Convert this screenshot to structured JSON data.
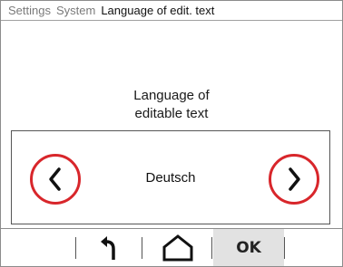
{
  "breadcrumb": {
    "items": [
      "Settings",
      "System"
    ],
    "current": "Language of edit. text"
  },
  "page": {
    "title_line1": "Language of",
    "title_line2": "editable text"
  },
  "selector": {
    "value": "Deutsch",
    "prev_icon": "chevron-left-icon",
    "next_icon": "chevron-right-icon",
    "highlight_color": "#d8262b"
  },
  "footer": {
    "back_icon": "back-arrow-icon",
    "home_icon": "home-icon",
    "ok_label": "OK"
  }
}
